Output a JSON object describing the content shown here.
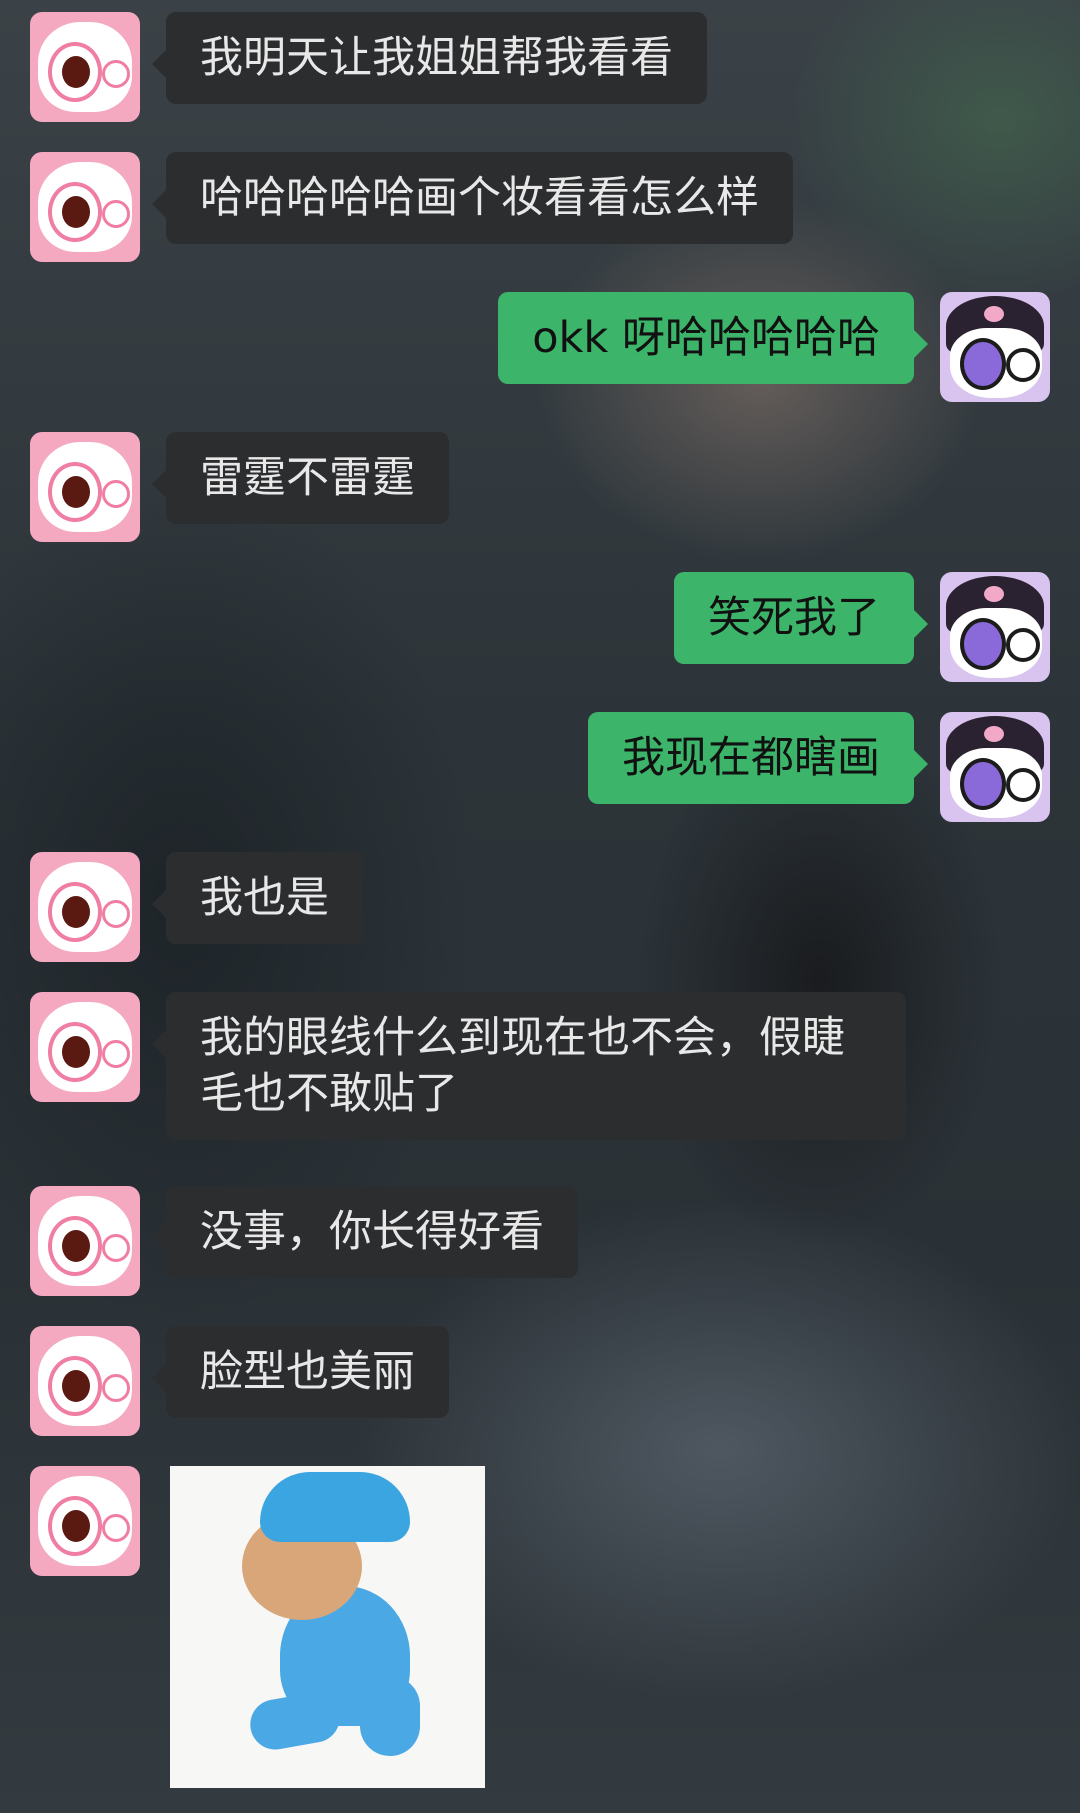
{
  "messages": [
    {
      "side": "left",
      "text": "我明天让我姐姐帮我看看"
    },
    {
      "side": "left",
      "text": "哈哈哈哈哈画个妆看看怎么样"
    },
    {
      "side": "right",
      "text": "okk 呀哈哈哈哈哈"
    },
    {
      "side": "left",
      "text": "雷霆不雷霆"
    },
    {
      "side": "right",
      "text": "笑死我了"
    },
    {
      "side": "right",
      "text": "我现在都瞎画"
    },
    {
      "side": "left",
      "text": "我也是"
    },
    {
      "side": "left",
      "text": "我的眼线什么到现在也不会，假睫\n毛也不敢贴了"
    },
    {
      "side": "left",
      "text": "没事，你长得好看"
    },
    {
      "side": "left",
      "text": "脸型也美丽"
    },
    {
      "side": "left",
      "sticker": "pocoyo-sticker"
    }
  ],
  "colors": {
    "incoming_bubble": "#2c2d2f",
    "outgoing_bubble": "#3cb56a",
    "incoming_text": "#e8e8e8",
    "outgoing_text": "#111111"
  },
  "avatars": {
    "left": "pink-cartoon-avatar",
    "right": "purple-kuromi-avatar"
  }
}
